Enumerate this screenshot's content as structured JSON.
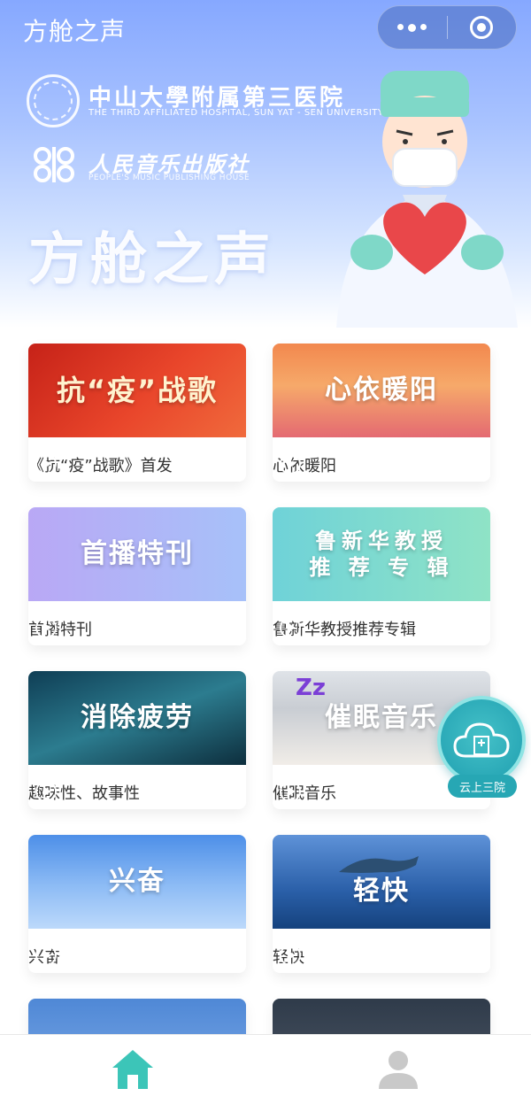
{
  "nav": {
    "title": "方舱之声",
    "more_icon": "more-dots-icon",
    "close_icon": "target-circle-icon"
  },
  "banner": {
    "hospital_name_cn": "中山大學附属第三医院",
    "hospital_name_en": "THE THIRD AFFILIATED HOSPITAL, SUN YAT - SEN UNIVERSITY",
    "publisher_name_cn": "人民音乐出版社",
    "publisher_name_en": "PEOPLE'S MUSIC PUBLISHING HOUSE",
    "headline": "方舱之声"
  },
  "cards": [
    {
      "thumb_text": "抗“疫”战歌",
      "caption": "《抗“疫”战歌》首发"
    },
    {
      "thumb_text": "心依暖阳",
      "caption": "心依暖阳"
    },
    {
      "thumb_text": "首播特刊",
      "caption": "首播特刊"
    },
    {
      "thumb_text": "鲁新华教授\n推 荐 专 辑",
      "caption": "鲁新华教授推荐专辑"
    },
    {
      "thumb_text": "消除疲劳",
      "caption": "趣味性、故事性"
    },
    {
      "thumb_text": "催眠音乐",
      "caption": "催眠音乐"
    },
    {
      "thumb_text": "兴奋",
      "caption": "兴奋"
    },
    {
      "thumb_text": "轻快",
      "caption": "轻快"
    }
  ],
  "float_badge": {
    "label": "云上三院",
    "icon": "cloud-hospital-icon"
  },
  "tabbar": {
    "home_icon": "home-icon",
    "profile_icon": "user-icon"
  },
  "colors": {
    "accent": "#2fb9b6",
    "banner_top": "#86a8ff",
    "text": "#333333"
  }
}
